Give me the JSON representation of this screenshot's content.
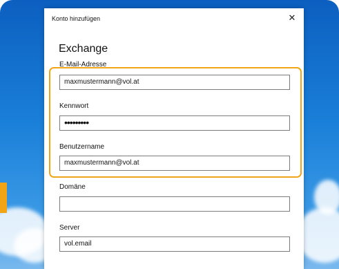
{
  "dialog": {
    "title": "Konto hinzufügen",
    "close_glyph": "✕",
    "heading": "Exchange"
  },
  "fields": {
    "email": {
      "label": "E-Mail-Adresse",
      "value": "maxmustermann@vol.at"
    },
    "password": {
      "label": "Kennwort",
      "value": "•••••••••"
    },
    "username": {
      "label": "Benutzername",
      "value": "maxmustermann@vol.at"
    },
    "domain": {
      "label": "Domäne",
      "value": ""
    },
    "server": {
      "label": "Server",
      "value": "vol.email"
    }
  },
  "colors": {
    "highlight": "#f1a516",
    "backdrop": "#1a7fd8"
  },
  "icons": {
    "close": "close-icon"
  }
}
